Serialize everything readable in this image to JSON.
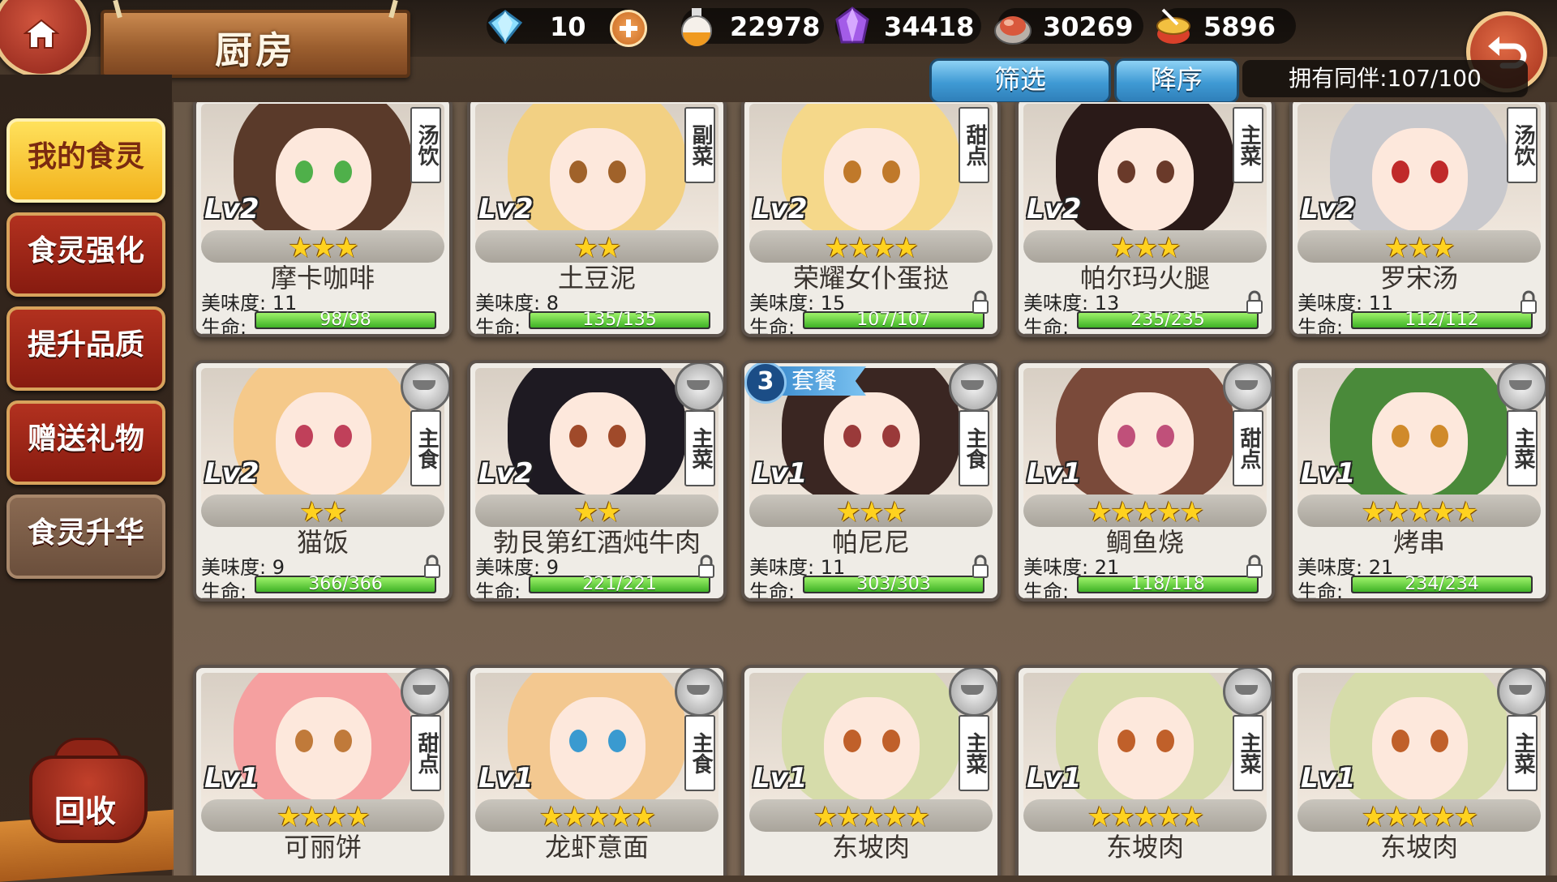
{
  "header": {
    "title": "厨房",
    "resources": [
      {
        "name": "diamond-icon",
        "value": "10",
        "color": "#7fd3ff"
      },
      {
        "name": "potion-icon",
        "value": "22978",
        "color": "#f0a030"
      },
      {
        "name": "purple-crystal-icon",
        "value": "34418",
        "color": "#a85ce8"
      },
      {
        "name": "meat-icon",
        "value": "30269",
        "color": "#d9583c"
      },
      {
        "name": "drum-icon",
        "value": "5896",
        "color": "#e9b430"
      }
    ]
  },
  "toolbar": {
    "filter_label": "筛选",
    "sort_label": "降序",
    "owned_text": "拥有同伴:107/100"
  },
  "sidebar": {
    "items": [
      {
        "label": "我的食灵",
        "active": true
      },
      {
        "label": "食灵强化",
        "active": false
      },
      {
        "label": "提升品质",
        "active": false
      },
      {
        "label": "赠送礼物",
        "active": false
      },
      {
        "label": "食灵升华",
        "active": false
      }
    ],
    "recycle_label": "回收"
  },
  "labels": {
    "taste": "美味度:",
    "hp": "生命:"
  },
  "cards": [
    {
      "level": "Lv2",
      "type": "汤饮",
      "stars": "★★★",
      "name": "摩卡咖啡",
      "taste": "11",
      "hp": "98/98",
      "locked": false,
      "hair": "#5a3a2a",
      "eye": "#4fb04a"
    },
    {
      "level": "Lv2",
      "type": "副菜",
      "stars": "★★",
      "name": "土豆泥",
      "taste": "8",
      "hp": "135/135",
      "locked": false,
      "hair": "#f2d083",
      "eye": "#a0622a"
    },
    {
      "level": "Lv2",
      "type": "甜点",
      "stars": "★★★★",
      "name": "荣耀女仆蛋挞",
      "taste": "15",
      "hp": "107/107",
      "locked": true,
      "hair": "#f5d88a",
      "eye": "#c0792a"
    },
    {
      "level": "Lv2",
      "type": "主菜",
      "stars": "★★★",
      "name": "帕尔玛火腿",
      "taste": "13",
      "hp": "235/235",
      "locked": true,
      "hair": "#2a1a18",
      "eye": "#6a3a2a"
    },
    {
      "level": "Lv2",
      "type": "汤饮",
      "stars": "★★★",
      "name": "罗宋汤",
      "taste": "11",
      "hp": "112/112",
      "locked": true,
      "hair": "#c8c8cc",
      "eye": "#c02a2a"
    },
    {
      "level": "Lv2",
      "type": "主食",
      "stars": "★★",
      "name": "猫饭",
      "taste": "9",
      "hp": "366/366",
      "locked": true,
      "hair": "#f5c98a",
      "eye": "#c0405a",
      "badge": true
    },
    {
      "level": "Lv2",
      "type": "主菜",
      "stars": "★★",
      "name": "勃艮第红酒炖牛肉",
      "taste": "9",
      "hp": "221/221",
      "locked": true,
      "hair": "#1e1a22",
      "eye": "#a04a2a",
      "badge": true
    },
    {
      "level": "Lv1",
      "type": "主食",
      "stars": "★★★",
      "name": "帕尼尼",
      "taste": "11",
      "hp": "303/303",
      "locked": true,
      "hair": "#3a2622",
      "eye": "#9a3a3a",
      "badge": true,
      "set_num": "3",
      "set_label": "套餐"
    },
    {
      "level": "Lv1",
      "type": "甜点",
      "stars": "★★★★★",
      "name": "鲷鱼烧",
      "taste": "21",
      "hp": "118/118",
      "locked": true,
      "hair": "#7a4a3a",
      "eye": "#c0507a",
      "badge": true
    },
    {
      "level": "Lv1",
      "type": "主菜",
      "stars": "★★★★★",
      "name": "烤串",
      "taste": "21",
      "hp": "234/234",
      "locked": false,
      "hair": "#4a8a3a",
      "eye": "#d08a2a",
      "badge": true
    },
    {
      "level": "Lv1",
      "type": "甜点",
      "stars": "★★★★",
      "name": "可丽饼",
      "taste": "",
      "hp": "",
      "locked": false,
      "hair": "#f5a0a0",
      "eye": "#c07a3a",
      "badge": true
    },
    {
      "level": "Lv1",
      "type": "主食",
      "stars": "★★★★★",
      "name": "龙虾意面",
      "taste": "",
      "hp": "",
      "locked": false,
      "hair": "#f3c890",
      "eye": "#3a9ad0",
      "badge": true
    },
    {
      "level": "Lv1",
      "type": "主菜",
      "stars": "★★★★★",
      "name": "东坡肉",
      "taste": "",
      "hp": "",
      "locked": false,
      "hair": "#d6dcaa",
      "eye": "#c0602a",
      "badge": true
    },
    {
      "level": "Lv1",
      "type": "主菜",
      "stars": "★★★★★",
      "name": "东坡肉",
      "taste": "",
      "hp": "",
      "locked": false,
      "hair": "#d6dcaa",
      "eye": "#c0602a",
      "badge": true
    },
    {
      "level": "Lv1",
      "type": "主菜",
      "stars": "★★★★★",
      "name": "东坡肉",
      "taste": "",
      "hp": "",
      "locked": false,
      "hair": "#d6dcaa",
      "eye": "#c0602a",
      "badge": true
    }
  ]
}
